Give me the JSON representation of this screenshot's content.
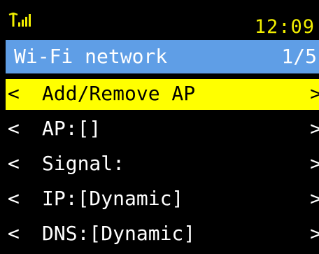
{
  "status": {
    "time": "12:09",
    "signal_icon": "signal-antenna-icon",
    "accent_color": "#f1ee00"
  },
  "title_bar": {
    "title": "Wi-Fi network",
    "page": "1/5",
    "color": "#5f9ee6"
  },
  "menu": {
    "selected_color": "#ffff00",
    "items": [
      {
        "label": "Add/Remove AP",
        "left_arrow": "<",
        "right_arrow": ">",
        "selected": true
      },
      {
        "label": "AP:[]",
        "left_arrow": "<",
        "right_arrow": ">",
        "selected": false
      },
      {
        "label": "Signal:",
        "left_arrow": "<",
        "right_arrow": ">",
        "selected": false
      },
      {
        "label": "IP:[Dynamic]",
        "left_arrow": "<",
        "right_arrow": ">",
        "selected": false
      },
      {
        "label": "DNS:[Dynamic]",
        "left_arrow": "<",
        "right_arrow": ">",
        "selected": false
      }
    ]
  }
}
